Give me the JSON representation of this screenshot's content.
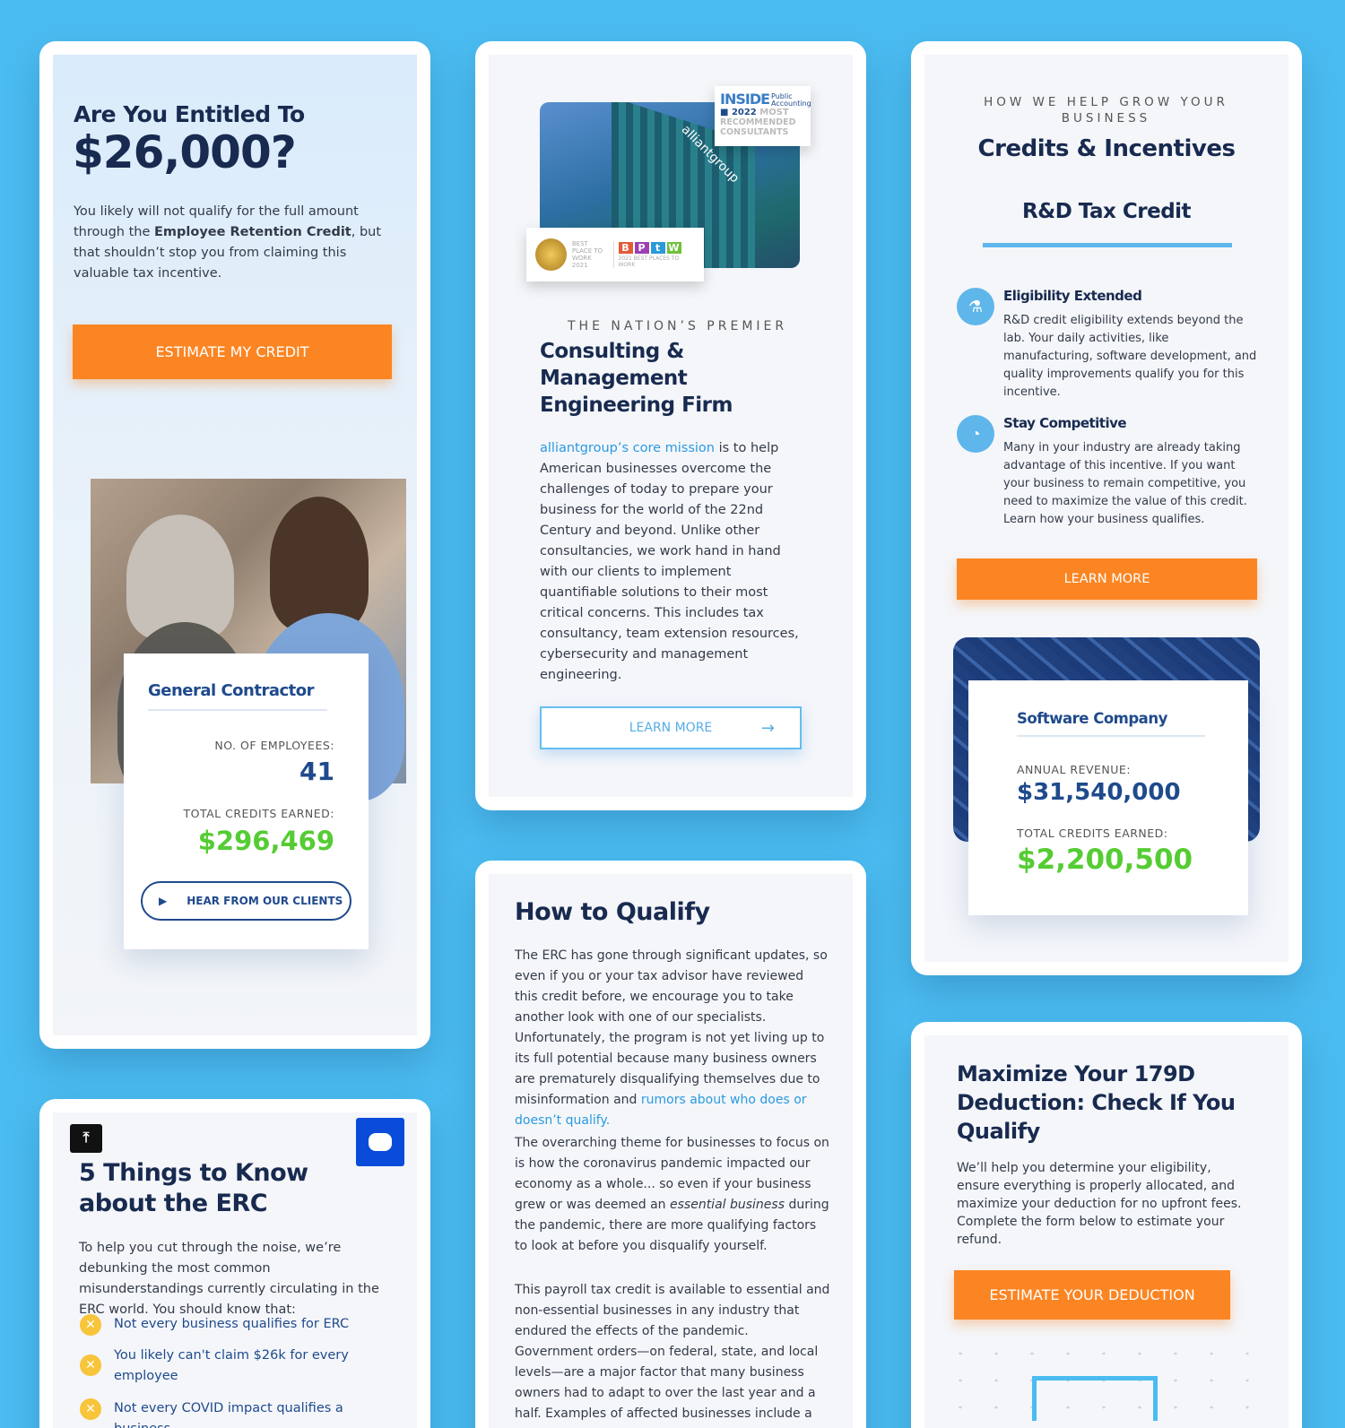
{
  "card1": {
    "title_line1": "Are You Entitled To",
    "title_line2": "$26,000?",
    "desc_pre": "You likely will not qualify for the full amount through the ",
    "desc_bold": "Employee Retention Credit",
    "desc_post": ", but that shouldn’t stop you from claiming this valuable tax incentive.",
    "cta": "ESTIMATE MY CREDIT",
    "stat": {
      "title": "General Contractor",
      "label1": "NO. OF EMPLOYEES:",
      "value1": "41",
      "label2": "TOTAL CREDITS EARNED:",
      "value2": "$296,469",
      "video_button": "HEAR FROM OUR CLIENTS"
    }
  },
  "card2": {
    "badge_inside": "INSIDE",
    "badge_public": "Public",
    "badge_accounting": "Accounting",
    "badge_year": "2022",
    "badge_most": "MOST",
    "badge_rec": "RECOMMENDED",
    "badge_cons": "CONSULTANTS",
    "award1": "BEST PLACE TO WORK 2021",
    "award2_letters": [
      "B",
      "P",
      "t",
      "W"
    ],
    "award2_text": "2021 BEST PLACES TO WORK",
    "building_sign": "alliantgroup",
    "eyebrow": "THE NATION’S PREMIER",
    "title": "Consulting & Management Engineering Firm",
    "desc_link": "alliantgroup’s core mission",
    "desc_rest": " is to help American businesses overcome the challenges of today to prepare your business for the world of the 22nd Century and beyond. Unlike other consultancies, we work hand in hand with our clients to implement quantifiable solutions to their most critical concerns. This includes tax consultancy, team extension resources, cybersecurity and management engineering.",
    "cta": "LEARN MORE"
  },
  "card3": {
    "eyebrow": "HOW WE HELP GROW YOUR BUSINESS",
    "title": "Credits & Incentives",
    "tab": "R&D Tax Credit",
    "items": [
      {
        "icon": "flask-icon",
        "title": "Eligibility Extended",
        "text": "R&D credit eligibility extends beyond the lab. Your daily activities, like manufacturing, software development, and quality improvements qualify you for this incentive."
      },
      {
        "icon": "pie-chart-icon",
        "title": "Stay Competitive",
        "text": "Many in your industry are already taking advantage of this incentive. If you want your business to remain competitive, you need to maximize the value of this credit. Learn how your business qualifies."
      }
    ],
    "cta": "LEARN MORE",
    "stat": {
      "title": "Software Company",
      "label1": "ANNUAL REVENUE:",
      "value1": "$31,540,000",
      "label2": "TOTAL CREDITS EARNED:",
      "value2": "$2,200,500"
    }
  },
  "card4": {
    "title": "5 Things to Know about the ERC",
    "desc": "To help you cut through the noise, we’re debunking the most common misunderstandings currently circulating in the ERC world. You should know that:",
    "bullets": [
      "Not every business qualifies for ERC",
      "You likely can't claim $26k for every employee",
      "Not every COVID impact qualifies a business"
    ]
  },
  "card5": {
    "title": "How to Qualify",
    "p1": "The ERC has gone through significant updates, so even if you or your tax advisor have reviewed this credit before, we encourage you to take another look with one of our specialists. Unfortunately, the program is not yet living up to its full potential because many business owners are prematurely disqualifying themselves due to misinformation and ",
    "p1_link": "rumors about who does or doesn’t qualify.",
    "p2_pre": "The overarching theme for businesses to focus on is how the coronavirus pandemic impacted our economy as a whole... so even if your business grew or was deemed an ",
    "p2_em": "essential business",
    "p2_post": " during the pandemic, there are more qualifying factors to look at before you disqualify yourself.",
    "p3": "This payroll tax credit is available to essential and non-essential businesses in any industry that endured the effects of the pandemic. Government orders—on federal, state, and local levels—are a major factor that many business owners had to adapt to over the last year and a half. Examples of affected businesses include a restaurant that could"
  },
  "card6": {
    "title": "Maximize Your 179D Deduction: Check If You Qualify",
    "desc": "We’ll help you determine your eligibility, ensure everything is properly allocated, and maximize your deduction for no upfront fees. Complete the form below to estimate your refund.",
    "cta": "ESTIMATE YOUR DEDUCTION"
  }
}
